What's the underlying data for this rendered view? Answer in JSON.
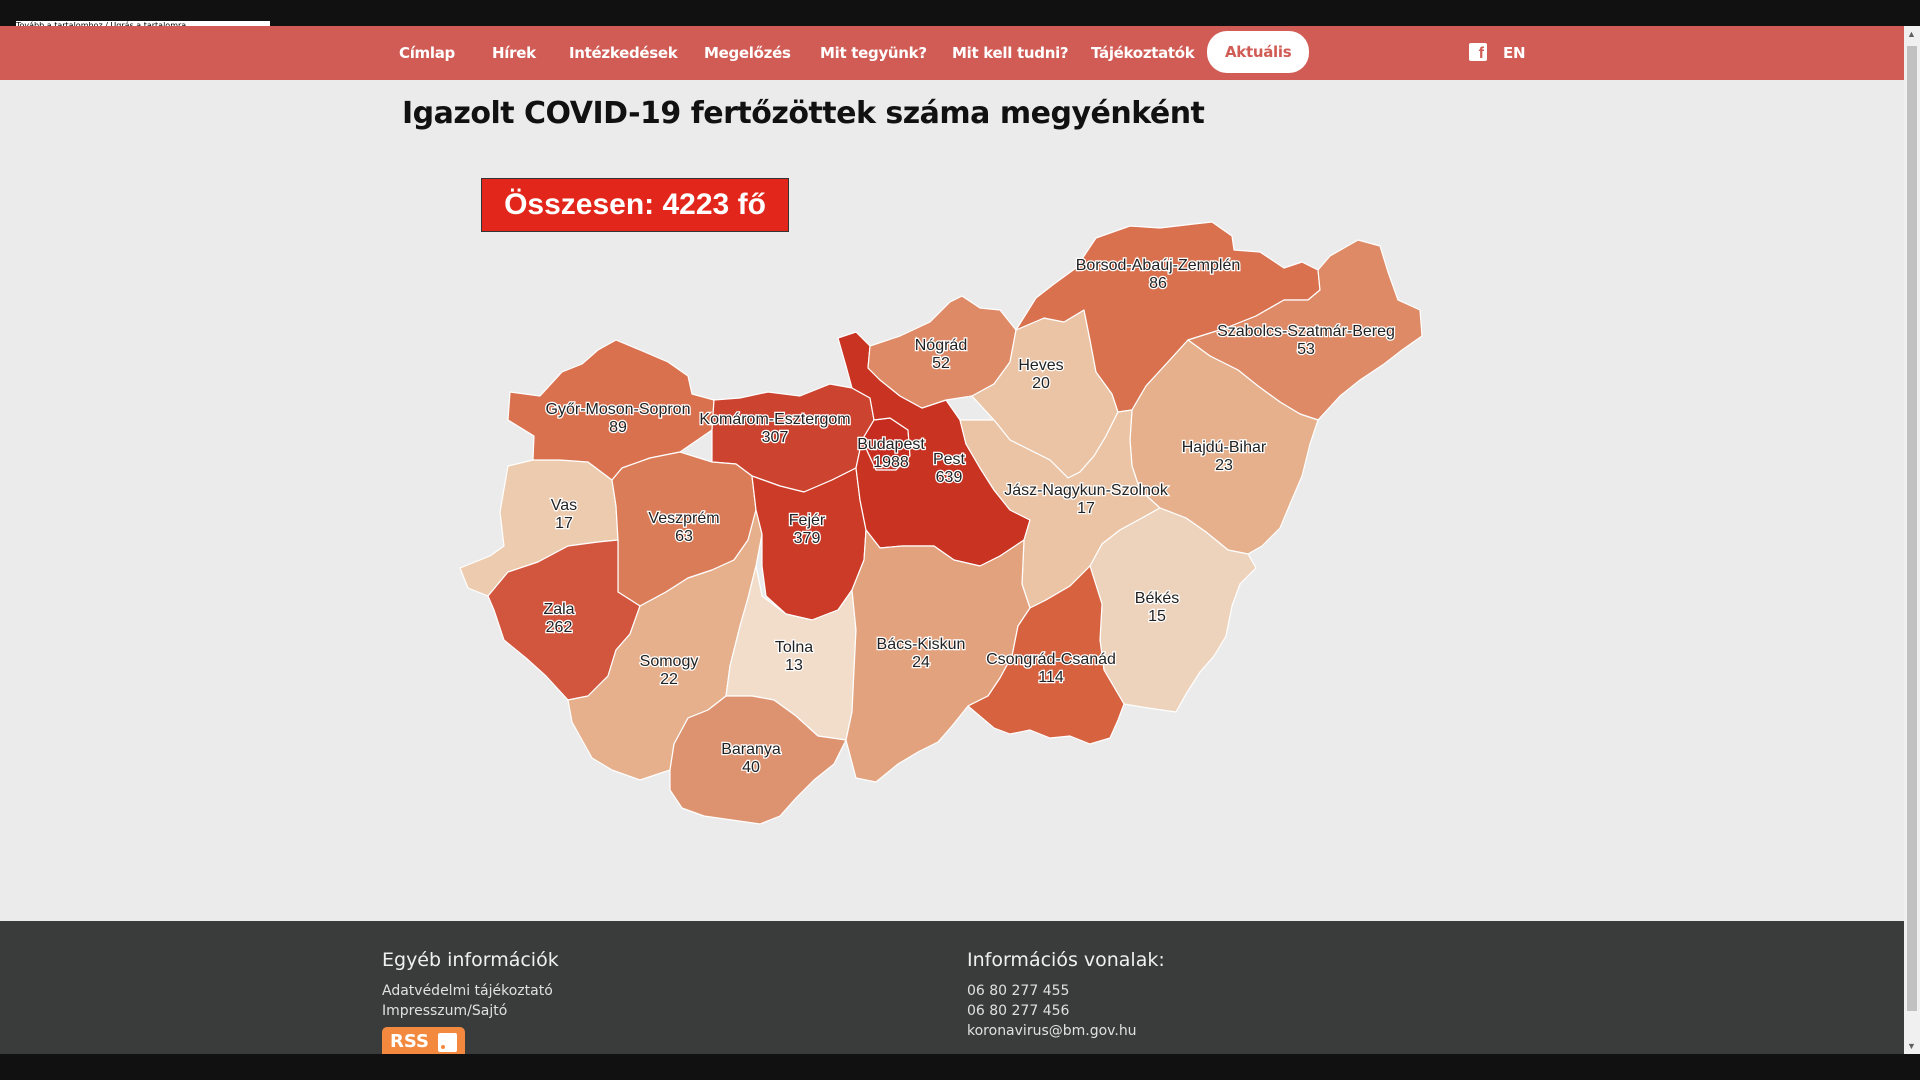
{
  "tooltip": "Tovább a tartalomhoz / Ugrás a tartalomra",
  "nav": {
    "items": [
      "Címlap",
      "Hírek",
      "Intézkedések",
      "Megelőzés",
      "Mit tegyünk?",
      "Mit kell tudni?",
      "Tájékoztatók"
    ],
    "active": "Aktuális",
    "lang": "EN",
    "facebook_icon": "facebook-icon"
  },
  "map": {
    "title": "Igazolt COVID-19 fertőzöttek száma megyénként",
    "total": "Összesen: 4223 fő",
    "regions": [
      {
        "name": "Borsod-Abaúj-Zemplén",
        "value": "86",
        "color": "#d9714f"
      },
      {
        "name": "Szabolcs-Szatmár-Bereg",
        "value": "53",
        "color": "#de8a66"
      },
      {
        "name": "Nógrád",
        "value": "52",
        "color": "#de8a66"
      },
      {
        "name": "Heves",
        "value": "20",
        "color": "#ebc4a5"
      },
      {
        "name": "Győr-Moson-Sopron",
        "value": "89",
        "color": "#d9714f"
      },
      {
        "name": "Komárom-Esztergom",
        "value": "307",
        "color": "#cc4330"
      },
      {
        "name": "Budapest",
        "value": "1988",
        "color": "#c62c1f"
      },
      {
        "name": "Pest",
        "value": "639",
        "color": "#c93322"
      },
      {
        "name": "Hajdú-Bihar",
        "value": "23",
        "color": "#e6b08c"
      },
      {
        "name": "Vas",
        "value": "17",
        "color": "#eccbaf"
      },
      {
        "name": "Veszprém",
        "value": "63",
        "color": "#da7c58"
      },
      {
        "name": "Fejér",
        "value": "379",
        "color": "#cc3b27"
      },
      {
        "name": "Jász-Nagykun-Szolnok",
        "value": "17",
        "color": "#ebc4a5"
      },
      {
        "name": "Zala",
        "value": "262",
        "color": "#d2553e"
      },
      {
        "name": "Békés",
        "value": "15",
        "color": "#eed3bc"
      },
      {
        "name": "Somogy",
        "value": "22",
        "color": "#e6b08c"
      },
      {
        "name": "Tolna",
        "value": "13",
        "color": "#f1ddca"
      },
      {
        "name": "Bács-Kiskun",
        "value": "24",
        "color": "#e3a27e"
      },
      {
        "name": "Csongrád-Csanád",
        "value": "114",
        "color": "#d6623f"
      },
      {
        "name": "Baranya",
        "value": "40",
        "color": "#de9370"
      }
    ]
  },
  "footer": {
    "left_title": "Egyéb információk",
    "left_links": [
      "Adatvédelmi tájékoztató",
      "Impresszum/Sajtó"
    ],
    "rss": "RSS",
    "right_title": "Információs vonalak:",
    "right_lines": [
      "06 80 277 455",
      "06 80 277 456",
      "koronavirus@bm.gov.hu"
    ]
  }
}
